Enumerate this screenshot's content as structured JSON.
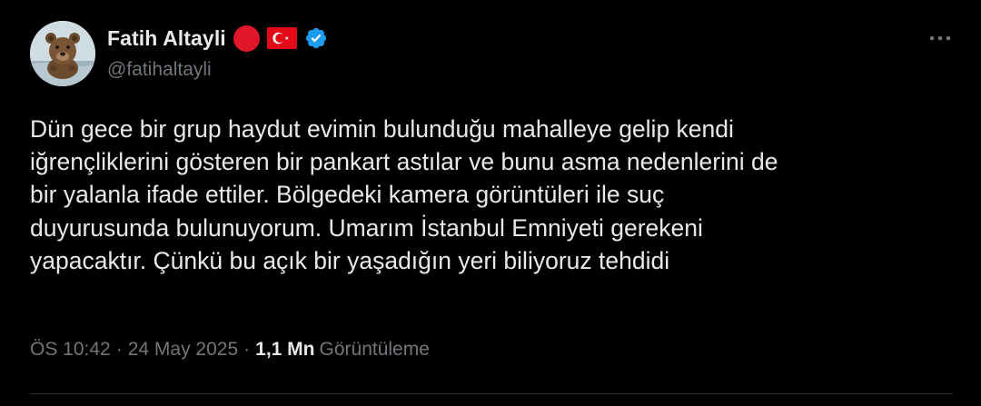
{
  "author": {
    "display_name": "Fatih Altayli",
    "handle": "@fatihaltayli",
    "avatar_icon": "bear-avatar-icon",
    "badges": [
      "red-circle-icon",
      "turkey-flag-icon",
      "verified-badge-icon"
    ]
  },
  "tweet": {
    "lines": [
      "Dün gece bir grup haydut evimin bulunduğu mahalleye gelip kendi",
      "iğrençliklerini gösteren bir pankart astılar ve bunu asma nedenlerini de",
      "bir yalanla ifade ettiler. Bölgedeki kamera görüntüleri ile suç",
      "duyurusunda bulunuyorum. Umarım İstanbul Emniyeti gerekeni",
      "yapacaktır. Çünkü bu açık bir yaşadığın yeri biliyoruz tehdidi"
    ]
  },
  "meta": {
    "time": "ÖS 10:42",
    "separator": "·",
    "date": "24 May 2025",
    "views_count": "1,1 Mn",
    "views_label": "Görüntüleme"
  },
  "more_icon": "more-dots-icon",
  "colors": {
    "background": "#000000",
    "primary_text": "#e7e9ea",
    "secondary_text": "#71767b",
    "verified": "#1d9bf0",
    "flag_red": "#e30a17",
    "divider": "#2f3336"
  }
}
